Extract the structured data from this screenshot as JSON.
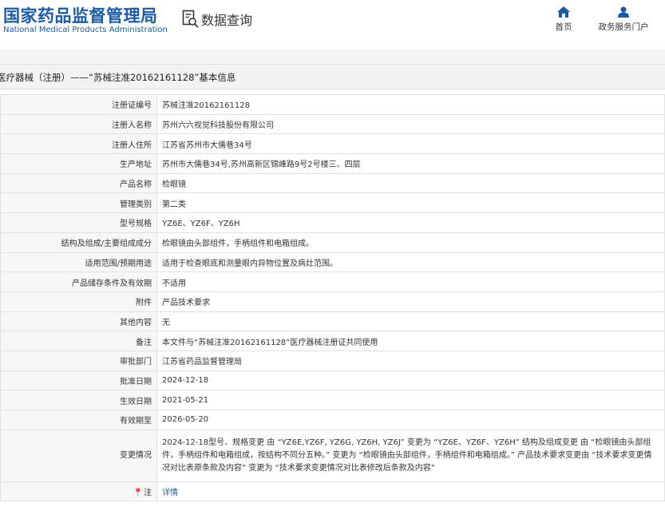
{
  "header": {
    "logo_cn": "国家药品监督管理局",
    "logo_en": "National Medical Products Administration",
    "query_label": "数据查询",
    "query_icon": "search-document-icon",
    "nav": [
      {
        "label": "首页",
        "icon": "home-icon"
      },
      {
        "label": "政务服务门户",
        "icon": "user-icon"
      }
    ],
    "brand_color": "#1c5aa6"
  },
  "title": "医疗器械（注册）——“苏械注准20162161128”基本信息",
  "rows": [
    {
      "label": "注册证编号",
      "value": "苏械注准20162161128"
    },
    {
      "label": "注册人名称",
      "value": "苏州六六视觉科技股份有限公司"
    },
    {
      "label": "注册人住所",
      "value": "江苏省苏州市大儒巷34号"
    },
    {
      "label": "生产地址",
      "value": "苏州市大儒巷34号,苏州高新区锦峰路9号2号楼三、四层"
    },
    {
      "label": "产品名称",
      "value": "检眼镜"
    },
    {
      "label": "管理类别",
      "value": "第二类"
    },
    {
      "label": "型号规格",
      "value": "YZ6E、YZ6F、YZ6H"
    },
    {
      "label": "结构及组成/主要组成成分",
      "value": "检眼镜由头部组件，手柄组件和电箱组成。"
    },
    {
      "label": "适用范围/预期用途",
      "value": "适用于检查眼底和测量眼内异物位置及病灶范围。"
    },
    {
      "label": "产品储存条件及有效期",
      "value": "不适用"
    },
    {
      "label": "附件",
      "value": "产品技术要求"
    },
    {
      "label": "其他内容",
      "value": "无"
    },
    {
      "label": "备注",
      "value": "本文件与“苏械注准20162161128”医疗器械注册证共同使用"
    },
    {
      "label": "审批部门",
      "value": "江苏省药品监督管理局"
    },
    {
      "label": "批准日期",
      "value": "2024-12-18"
    },
    {
      "label": "生效日期",
      "value": "2021-05-21"
    },
    {
      "label": "有效期至",
      "value": "2026-05-20"
    },
    {
      "label": "变更情况",
      "value": "2024-12-18型号、规格变更 由 “YZ6E,YZ6F, YZ6G, YZ6H, YZ6J” 变更为 “YZ6E、YZ6F、YZ6H” 结构及组成变更 由 “检眼镜由头部组件，手柄组件和电箱组成，按结构不同分五种。” 变更为 “检眼镜由头部组件，手柄组件和电箱组成。” 产品技术要求变更由 “技术要求变更情况对比表原条款及内容” 变更为 “技术要求变更情况对比表修改后条款及内容”"
    }
  ],
  "note": {
    "label": "注",
    "icon": "pin-icon",
    "link": "详情"
  }
}
